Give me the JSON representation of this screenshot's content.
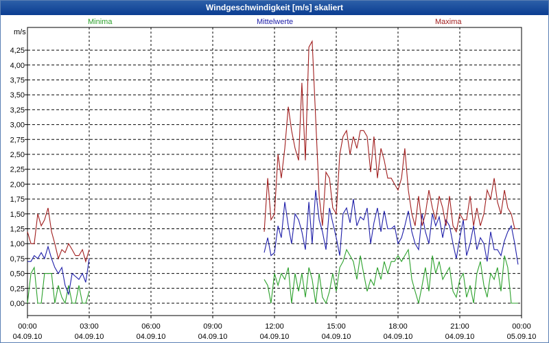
{
  "window": {
    "title": "Windgeschwindigkeit [m/s] skaliert"
  },
  "chart_data": {
    "type": "line",
    "title": "Windgeschwindigkeit [m/s] skaliert",
    "ylabel": "m/s",
    "xlabel": "",
    "ylim": [
      -0.2,
      4.6
    ],
    "xlim": [
      0,
      24
    ],
    "grid": true,
    "legend_placement": "top",
    "y_ticks": [
      "0,00",
      "0,25",
      "0,50",
      "0,75",
      "1,00",
      "1,25",
      "1,50",
      "1,75",
      "2,00",
      "2,25",
      "2,50",
      "2,75",
      "3,00",
      "3,25",
      "3,50",
      "3,75",
      "4,00",
      "4,25"
    ],
    "x_ticks": [
      {
        "time": "00:00",
        "date": "04.09.10"
      },
      {
        "time": "03:00",
        "date": "04.09.10"
      },
      {
        "time": "06:00",
        "date": "04.09.10"
      },
      {
        "time": "09:00",
        "date": "04.09.10"
      },
      {
        "time": "12:00",
        "date": "04.09.10"
      },
      {
        "time": "15:00",
        "date": "04.09.10"
      },
      {
        "time": "18:00",
        "date": "04.09.10"
      },
      {
        "time": "21:00",
        "date": "04.09.10"
      },
      {
        "time": "00:00",
        "date": "05.09.10"
      }
    ],
    "series": [
      {
        "name": "Minima",
        "color": "#2aa02a",
        "segments": [
          {
            "x": [
              0,
              0.17,
              0.33,
              0.5,
              0.67,
              0.83,
              1,
              1.17,
              1.33,
              1.5,
              1.67,
              1.83,
              2,
              2.17,
              2.33,
              2.5,
              2.67,
              2.83,
              3
            ],
            "y": [
              0,
              0.5,
              0.6,
              0,
              0,
              0.5,
              0.5,
              0.5,
              0,
              0.3,
              0.1,
              0,
              0.3,
              0,
              0,
              0.3,
              0,
              0,
              0.2
            ]
          },
          {
            "x": [
              11.5,
              11.67,
              11.83,
              12,
              12.17,
              12.33,
              12.5,
              12.67,
              12.83,
              13,
              13.17,
              13.33,
              13.5,
              13.67,
              13.83,
              14,
              14.17,
              14.33,
              14.5,
              14.67,
              14.83,
              15,
              15.17,
              15.33,
              15.5,
              15.67,
              15.83,
              16,
              16.17,
              16.33,
              16.5,
              16.67,
              16.83,
              17,
              17.17,
              17.33,
              17.5,
              17.67,
              17.83,
              18,
              18.17,
              18.33,
              18.5,
              18.67,
              18.83,
              19,
              19.17,
              19.33,
              19.5,
              19.67,
              19.83,
              20,
              20.17,
              20.33,
              20.5,
              20.67,
              20.83,
              21,
              21.17,
              21.33,
              21.5,
              21.67,
              21.83,
              22,
              22.17,
              22.33,
              22.5,
              22.67,
              22.83,
              23,
              23.17,
              23.33,
              23.5,
              23.67,
              23.83
            ],
            "y": [
              0.4,
              0.3,
              0,
              0.5,
              0.3,
              0.5,
              0.4,
              0.6,
              0,
              0.5,
              0.2,
              0.5,
              0.1,
              0.6,
              0.4,
              0,
              0.5,
              0.1,
              0,
              0.2,
              0.5,
              0.2,
              0.6,
              0.7,
              0.9,
              0.8,
              0.7,
              0.4,
              0.8,
              0.5,
              0.2,
              0.4,
              0.3,
              0.6,
              0.4,
              0.7,
              0.5,
              0.7,
              0.7,
              0.8,
              0.7,
              0.8,
              0.9,
              0.4,
              0.2,
              0,
              0.3,
              0.6,
              0.2,
              0.8,
              0.5,
              0.7,
              0.4,
              0.5,
              0.6,
              0.2,
              0.1,
              0.4,
              0.5,
              0.1,
              0.3,
              0,
              0.5,
              0.7,
              0.3,
              0.1,
              0.5,
              0.4,
              0.6,
              0.2,
              0.8,
              0.6,
              0,
              0,
              0
            ]
          }
        ]
      },
      {
        "name": "Mittelwerte",
        "color": "#1c1ca8",
        "segments": [
          {
            "x": [
              0,
              0.17,
              0.33,
              0.5,
              0.67,
              0.83,
              1,
              1.17,
              1.33,
              1.5,
              1.67,
              1.83,
              2,
              2.17,
              2.33,
              2.5,
              2.67,
              2.83,
              3
            ],
            "y": [
              0.7,
              0.7,
              0.8,
              0.75,
              0.85,
              0.75,
              0.95,
              0.75,
              0.6,
              0.5,
              0.6,
              0.3,
              0.15,
              0.5,
              0.45,
              0.4,
              0.5,
              0.35,
              0.75
            ]
          },
          {
            "x": [
              11.5,
              11.67,
              11.83,
              12,
              12.17,
              12.33,
              12.5,
              12.67,
              12.83,
              13,
              13.17,
              13.33,
              13.5,
              13.67,
              13.83,
              14,
              14.17,
              14.33,
              14.5,
              14.67,
              14.83,
              15,
              15.17,
              15.33,
              15.5,
              15.67,
              15.83,
              16,
              16.17,
              16.33,
              16.5,
              16.67,
              16.83,
              17,
              17.17,
              17.33,
              17.5,
              17.67,
              17.83,
              18,
              18.17,
              18.33,
              18.5,
              18.67,
              18.83,
              19,
              19.17,
              19.33,
              19.5,
              19.67,
              19.83,
              20,
              20.17,
              20.33,
              20.5,
              20.67,
              20.83,
              21,
              21.17,
              21.33,
              21.5,
              21.67,
              21.83,
              22,
              22.17,
              22.33,
              22.5,
              22.67,
              22.83,
              23,
              23.17,
              23.33,
              23.5,
              23.67,
              23.83
            ],
            "y": [
              0.85,
              1.1,
              0.8,
              0.85,
              1.3,
              1.1,
              1.7,
              1.3,
              1.0,
              1.5,
              1.4,
              1.2,
              0.9,
              1.7,
              1.0,
              1.9,
              1.4,
              1.2,
              0.9,
              1.6,
              1.35,
              1.1,
              0.8,
              1.5,
              1.6,
              1.35,
              1.75,
              1.3,
              1.45,
              1.4,
              1.6,
              1.0,
              1.35,
              1.6,
              1.2,
              1.55,
              1.25,
              1.25,
              1.3,
              1.0,
              1.1,
              1.3,
              1.55,
              1.2,
              1.0,
              0.9,
              1.5,
              1.2,
              1.0,
              1.5,
              1.3,
              1.45,
              1.1,
              1.4,
              1.3,
              1.0,
              0.75,
              1.1,
              1.4,
              0.8,
              1.0,
              1.3,
              0.9,
              1.1,
              1.0,
              0.7,
              1.2,
              0.9,
              0.9,
              0.8,
              1.05,
              1.2,
              1.3,
              1.0,
              0.65
            ]
          }
        ]
      },
      {
        "name": "Maxima",
        "color": "#a01c1c",
        "segments": [
          {
            "x": [
              0,
              0.17,
              0.33,
              0.5,
              0.67,
              0.83,
              1,
              1.17,
              1.33,
              1.5,
              1.67,
              1.83,
              2,
              2.17,
              2.33,
              2.5,
              2.67,
              2.83,
              3
            ],
            "y": [
              1.2,
              1.0,
              1.0,
              1.5,
              1.3,
              1.4,
              1.6,
              1.2,
              1.0,
              0.75,
              0.9,
              0.85,
              1.0,
              0.9,
              0.8,
              0.8,
              0.9,
              0.7,
              0.9
            ]
          },
          {
            "x": [
              11.5,
              11.67,
              11.83,
              12,
              12.17,
              12.33,
              12.5,
              12.67,
              12.83,
              13,
              13.17,
              13.33,
              13.5,
              13.67,
              13.83,
              14,
              14.17,
              14.33,
              14.5,
              14.67,
              14.83,
              15,
              15.17,
              15.33,
              15.5,
              15.67,
              15.83,
              16,
              16.17,
              16.33,
              16.5,
              16.67,
              16.83,
              17,
              17.17,
              17.33,
              17.5,
              17.67,
              17.83,
              18,
              18.17,
              18.33,
              18.5,
              18.67,
              18.83,
              19,
              19.17,
              19.33,
              19.5,
              19.67,
              19.83,
              20,
              20.17,
              20.33,
              20.5,
              20.67,
              20.83,
              21,
              21.17,
              21.33,
              21.5,
              21.67,
              21.83,
              22,
              22.17,
              22.33,
              22.5,
              22.67,
              22.83,
              23,
              23.17,
              23.33,
              23.5,
              23.67,
              23.83
            ],
            "y": [
              1.2,
              2.1,
              1.4,
              1.5,
              2.5,
              2.1,
              2.6,
              3.3,
              2.9,
              2.6,
              2.4,
              3.7,
              2.4,
              4.3,
              4.4,
              3.1,
              1.8,
              1.3,
              2.2,
              2.1,
              1.6,
              1.5,
              2.5,
              2.8,
              2.9,
              2.5,
              2.8,
              2.6,
              2.9,
              2.9,
              2.8,
              2.2,
              2.8,
              2.1,
              2.6,
              2.4,
              2.1,
              2.1,
              2.0,
              1.9,
              2.1,
              2.6,
              1.9,
              1.5,
              1.3,
              1.8,
              1.3,
              1.5,
              1.9,
              1.6,
              1.4,
              1.8,
              1.6,
              1.3,
              1.8,
              1.3,
              1.2,
              1.5,
              1.4,
              1.4,
              1.8,
              1.3,
              1.6,
              1.3,
              1.5,
              1.9,
              1.75,
              2.1,
              1.7,
              1.5,
              1.9,
              1.6,
              1.5,
              1.25,
              1.25
            ]
          }
        ]
      }
    ]
  }
}
